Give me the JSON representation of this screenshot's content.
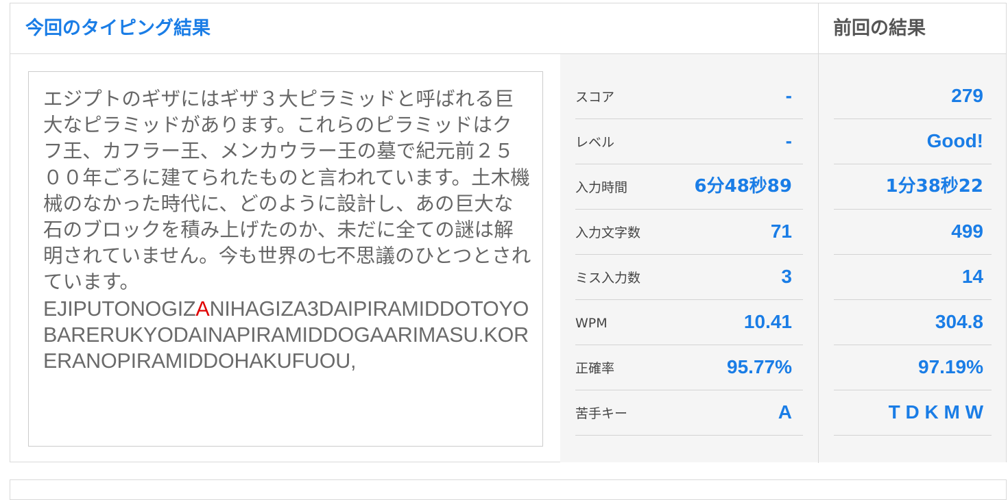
{
  "header": {
    "current_title": "今回のタイピング結果",
    "previous_title": "前回の結果"
  },
  "passage": {
    "japanese": "エジプトのギザにはギザ３大ピラミッドと呼ばれる巨大なピラミッドがあります。これらのピラミッドはクフ王、カフラー王、メンカウラー王の墓で紀元前２５００年ごろに建てられたものと言われています。土木機械のなかった時代に、どのように設計し、あの巨大な石のブロックを積み上げたのか、未だに全ての謎は解明されていません。今も世界の七不思議のひとつとされています。",
    "romaji_before_error": "EJIPUTONOGIZ",
    "romaji_error_char": "A",
    "romaji_after_error": "NIHAGIZA3DAIPIRAMIDDOTOYOBARERUKYODAINAPIRAMIDDOGAARIMASU.KORERANOPIRAMIDDOHAKUFUOU,",
    "error_color": "#e00000"
  },
  "stats": [
    {
      "label": "スコア",
      "current": "-",
      "previous": "279"
    },
    {
      "label": "レベル",
      "current": "-",
      "previous": "Good!"
    },
    {
      "label": "入力時間",
      "current": "6分48秒89",
      "previous": "1分38秒22"
    },
    {
      "label": "入力文字数",
      "current": "71",
      "previous": "499"
    },
    {
      "label": "ミス入力数",
      "current": "3",
      "previous": "14"
    },
    {
      "label": "WPM",
      "current": "10.41",
      "previous": "304.8"
    },
    {
      "label": "正確率",
      "current": "95.77%",
      "previous": "97.19%"
    },
    {
      "label": "苦手キー",
      "current": "A",
      "previous": "T D K M W"
    }
  ],
  "colors": {
    "accent": "#1a7de6",
    "panel_bg": "#f5f5f5",
    "border": "#d9d9d9"
  }
}
